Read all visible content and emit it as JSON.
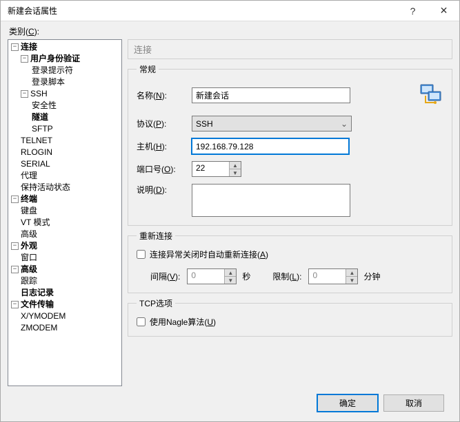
{
  "window": {
    "title": "新建会话属性"
  },
  "category_label": "类别",
  "category_hotkey": "C",
  "tree": {
    "connection": "连接",
    "user_auth": "用户身份验证",
    "login_prompt": "登录提示符",
    "login_script": "登录脚本",
    "ssh": "SSH",
    "security": "安全性",
    "tunnel": "隧道",
    "sftp": "SFTP",
    "telnet": "TELNET",
    "rlogin": "RLOGIN",
    "serial": "SERIAL",
    "proxy": "代理",
    "keepalive": "保持活动状态",
    "terminal": "终端",
    "keyboard": "键盘",
    "vt_mode": "VT 模式",
    "advanced": "高级",
    "appearance": "外观",
    "window": "窗口",
    "advanced2": "高级",
    "trace": "跟踪",
    "logging": "日志记录",
    "file_transfer": "文件传输",
    "xymodem": "X/YMODEM",
    "zmodem": "ZMODEM"
  },
  "section": {
    "title": "连接"
  },
  "general": {
    "legend": "常规",
    "name_label": "名称",
    "name_hotkey": "N",
    "name_value": "新建会话",
    "protocol_label": "协议",
    "protocol_hotkey": "P",
    "protocol_value": "SSH",
    "host_label": "主机",
    "host_hotkey": "H",
    "host_value": "192.168.79.128",
    "port_label": "端口号",
    "port_hotkey": "O",
    "port_value": "22",
    "desc_label": "说明",
    "desc_hotkey": "D",
    "desc_value": ""
  },
  "reconnect": {
    "legend": "重新连接",
    "chk_label": "连接异常关闭时自动重新连接",
    "chk_hotkey": "A",
    "interval_label": "间隔",
    "interval_hotkey": "V",
    "interval_value": "0",
    "seconds": "秒",
    "limit_label": "限制",
    "limit_hotkey": "L",
    "limit_value": "0",
    "minutes": "分钟"
  },
  "tcp": {
    "legend": "TCP选项",
    "nagle_label": "使用Nagle算法",
    "nagle_hotkey": "U"
  },
  "buttons": {
    "ok": "确定",
    "cancel": "取消"
  }
}
